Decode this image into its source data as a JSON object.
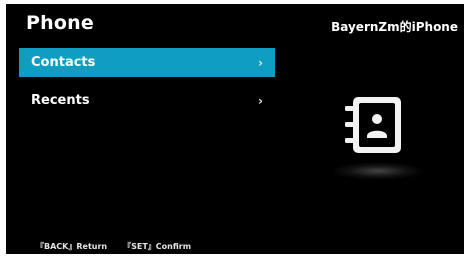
{
  "header": {
    "title": "Phone",
    "device_name": "BayernZm的iPhone"
  },
  "menu": {
    "items": [
      {
        "label": "Contacts",
        "selected": true,
        "chevron": "›"
      },
      {
        "label": "Recents",
        "selected": false,
        "chevron": "›"
      }
    ]
  },
  "illustration": {
    "icon": "contacts-book-icon"
  },
  "footer": {
    "hints": [
      "『BACK』Return",
      "『SET』Confirm"
    ]
  },
  "colors": {
    "background": "#000000",
    "selected_highlight": "#0f9ec2",
    "text": "#ffffff"
  }
}
